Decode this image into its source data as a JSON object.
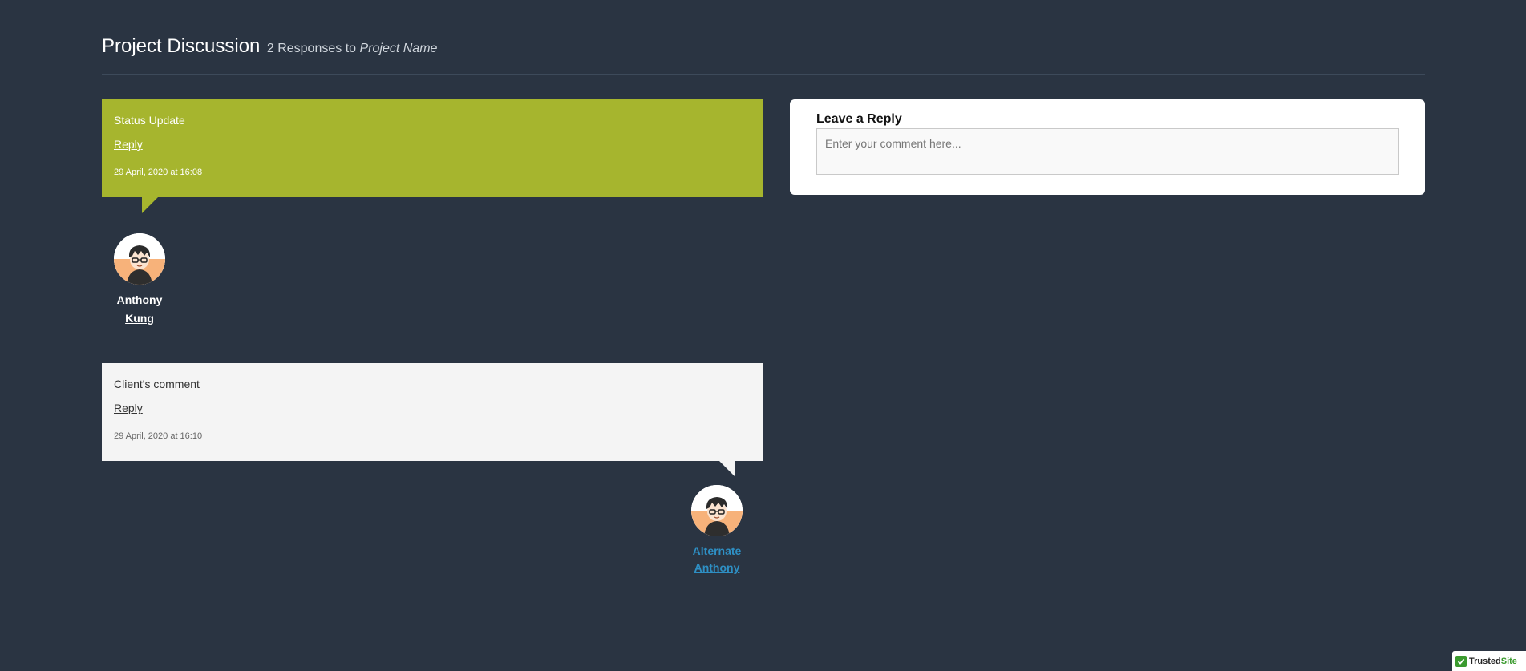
{
  "header": {
    "title": "Project Discussion",
    "responses_prefix": "2 Responses to",
    "project_name": "Project Name"
  },
  "comments": [
    {
      "text": "Status Update",
      "reply_label": "Reply",
      "date": "29 April, 2020 at 16:08",
      "author_first": "Anthony",
      "author_last": "Kung",
      "color": "#a6b52e"
    },
    {
      "text": "Client's comment",
      "reply_label": "Reply",
      "date": "29 April, 2020 at 16:10",
      "author_first": "Alternate",
      "author_last": "Anthony",
      "color": "#f4f4f4"
    }
  ],
  "reply_form": {
    "title": "Leave a Reply",
    "placeholder": "Enter your comment here..."
  },
  "badge": {
    "trusted": "Trusted",
    "site": "Site"
  },
  "colors": {
    "background": "#2a3442",
    "link_blue": "#2e8fc4",
    "badge_green": "#3a9a2e"
  }
}
